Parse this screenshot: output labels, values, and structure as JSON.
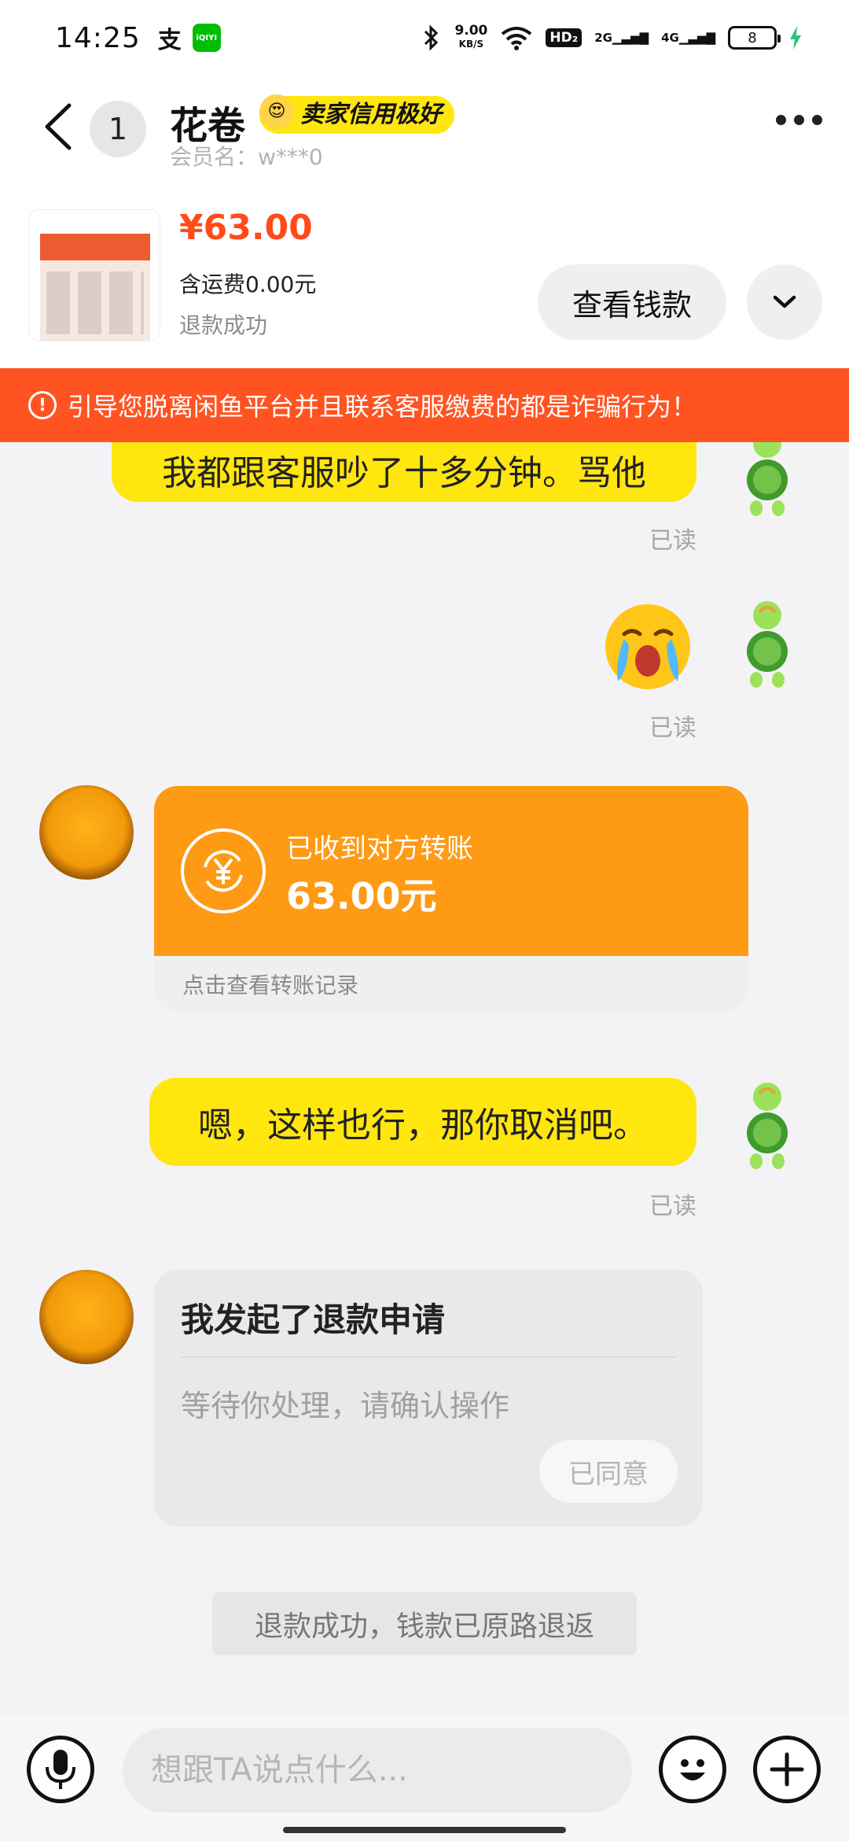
{
  "status_bar": {
    "time": "14:25",
    "app_icon_1": "支",
    "app_icon_2": "iQIYI",
    "net_speed_value": "9.00",
    "net_speed_unit": "KB/S",
    "hd_label": "HD₂",
    "sim1": "2G",
    "sim2": "4G",
    "battery": "8"
  },
  "header": {
    "unread_count": "1",
    "seller_name": "花卷",
    "credit_badge": "卖家信用极好",
    "member_label": "会员名：",
    "member_id": "w***0"
  },
  "product": {
    "price": "¥63.00",
    "shipping": "含运费0.00元",
    "status": "退款成功",
    "view_money_button": "查看钱款"
  },
  "warning_banner": {
    "text": "引导您脱离闲鱼平台并且联系客服缴费的都是诈骗行为！",
    "icon": "!"
  },
  "messages": {
    "msg1_text": "我都跟客服吵了十多分钟。骂他",
    "msg1_status": "已读",
    "msg2_status": "已读",
    "transfer": {
      "label": "已收到对方转账",
      "amount": "63.00元",
      "link": "点击查看转账记录"
    },
    "msg3_text": "嗯，这样也行，那你取消吧。",
    "msg3_status": "已读",
    "refund_card": {
      "title": "我发起了退款申请",
      "subtitle": "等待你处理，请确认操作",
      "button": "已同意"
    },
    "system_message": "退款成功，钱款已原路退返"
  },
  "input_bar": {
    "placeholder": "想跟TA说点什么..."
  },
  "colors": {
    "accent_yellow": "#ffe60f",
    "warning_orange": "#ff5322",
    "price_red": "#ff4b1a",
    "transfer_orange": "#ff9a14"
  }
}
